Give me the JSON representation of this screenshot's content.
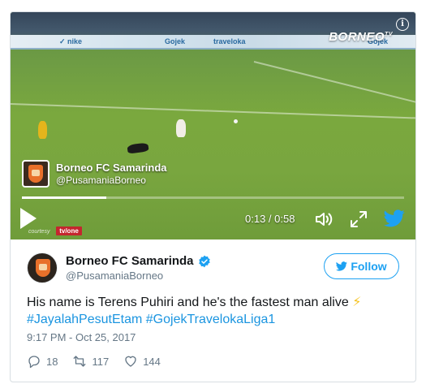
{
  "video": {
    "brand": "BORNEO",
    "brand_suffix": "TV",
    "channel": {
      "name": "Borneo FC Samarinda",
      "handle": "@PusamaniaBorneo"
    },
    "time_display": "0:13 / 0:58",
    "progress": 0.22,
    "courtesy_label": "courtesy",
    "tvone_label": "tv/one",
    "icons": [
      "info-icon",
      "play-icon",
      "volume-icon",
      "fullscreen-icon",
      "twitter-bird-icon"
    ]
  },
  "tweet": {
    "author": {
      "name": "Borneo FC Samarinda",
      "handle": "@PusamaniaBorneo",
      "verified": true
    },
    "follow_label": "Follow",
    "text": "His name is Terens Puhiri and he's the fastest man alive",
    "emoji": "⚡",
    "hashtags": [
      "#JayalahPesutEtam",
      "#GojekTravelokaLiga1"
    ],
    "timestamp": "9:17 PM - Oct 25, 2017",
    "stats": {
      "replies": "18",
      "retweets": "117",
      "likes": "144"
    }
  },
  "colors": {
    "accent": "#1da1f2",
    "hashtag": "#1b95e0",
    "muted": "#657786",
    "text": "#14171a",
    "border": "#d8dee2"
  }
}
